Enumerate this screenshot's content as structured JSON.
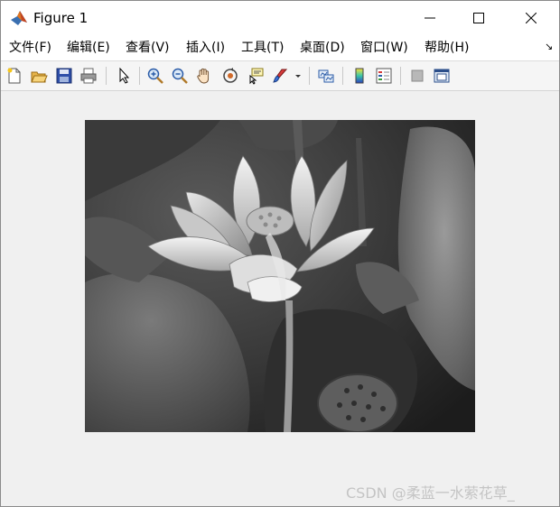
{
  "window": {
    "title": "Figure 1",
    "controls": {
      "minimize": "minimize",
      "maximize": "maximize",
      "close": "close"
    }
  },
  "menu": {
    "items": [
      {
        "label": "文件(F)"
      },
      {
        "label": "编辑(E)"
      },
      {
        "label": "查看(V)"
      },
      {
        "label": "插入(I)"
      },
      {
        "label": "工具(T)"
      },
      {
        "label": "桌面(D)"
      },
      {
        "label": "窗口(W)"
      },
      {
        "label": "帮助(H)"
      }
    ],
    "dock_arrow": "↘"
  },
  "toolbar": {
    "buttons": [
      {
        "icon": "new-figure-icon"
      },
      {
        "icon": "open-file-icon"
      },
      {
        "icon": "save-icon"
      },
      {
        "icon": "print-icon"
      },
      {
        "icon": "edit-plot-arrow-icon"
      },
      {
        "icon": "zoom-in-icon"
      },
      {
        "icon": "zoom-out-icon"
      },
      {
        "icon": "pan-hand-icon"
      },
      {
        "icon": "rotate-3d-icon"
      },
      {
        "icon": "data-cursor-icon"
      },
      {
        "icon": "brush-icon"
      },
      {
        "icon": "link-plot-icon"
      },
      {
        "icon": "colorbar-icon"
      },
      {
        "icon": "legend-icon"
      },
      {
        "icon": "hide-plot-tools-icon"
      },
      {
        "icon": "show-plot-tools-icon"
      }
    ]
  },
  "figure": {
    "content": "grayscale lotus flower photograph",
    "colormap": "gray"
  },
  "watermark": {
    "text": "CSDN @柔蓝一水萦花草_"
  },
  "colors": {
    "titlebar": "#ffffff",
    "background": "#f0f0f0",
    "toolbar": "#f5f5f5"
  }
}
